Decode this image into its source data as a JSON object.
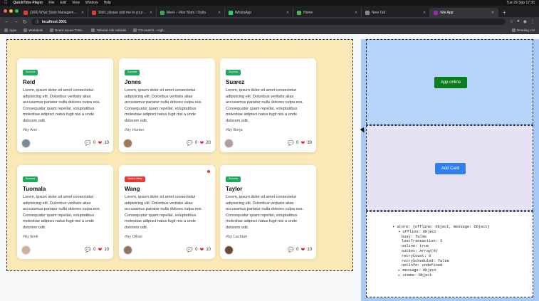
{
  "menubar": {
    "app": "QuickTime Player",
    "items": [
      "File",
      "Edit",
      "View",
      "Window",
      "Help"
    ],
    "clock": "Tue 29 Sep 17:30"
  },
  "tabs": [
    {
      "title": "(160) What State Management...",
      "color": "#e53935"
    },
    {
      "title": "Shirt, please add me to your l...",
      "color": "#e53935"
    },
    {
      "title": "Meet – Vitor Mato / Dalia",
      "color": "#34a853"
    },
    {
      "title": "WhatsApp",
      "color": "#25d366"
    },
    {
      "title": "Home",
      "color": "#4caf50"
    },
    {
      "title": "New Tab",
      "color": "#888888"
    },
    {
      "title": "Vite App",
      "color": "#9c27b0"
    }
  ],
  "address": {
    "url": "localhost:3001"
  },
  "bookmarks": {
    "items": [
      "Apps",
      "Workdesk",
      "Board Issues Tutor...",
      "Tailwind Lab Helsinki",
      "CN Search – Hgh..."
    ],
    "reading": "Reading List"
  },
  "cards": [
    {
      "badge": "Success",
      "badge_color": "#22a85b",
      "name": "Reid",
      "body": "Lorem, ipsum dolor sit amet consectetur adipisicing elit. Doloribus veritatis alias accusamus pariatur nulla dolores culpa eos. Consequatur quam repellat, voluptatibus molestiae adipisci natus fugit nisi a unde dolorem odit.",
      "by": "#by Ann",
      "comments": "0",
      "likes": "10",
      "avatar": "#7a8a9a",
      "dot": false
    },
    {
      "badge": "Success",
      "badge_color": "#22a85b",
      "name": "Jones",
      "body": "Lorem, ipsum dolor sit amet consectetur adipisicing elit. Doloribus veritatis alias accusamus pariatur nulla dolores culpa eos. Consequatur quam repellat, voluptatibus molestiae adipisci natus fugit nisi a unde dolorem odit.",
      "by": "#by Hunter",
      "comments": "0",
      "likes": "20",
      "avatar": "#a0785a",
      "dot": false
    },
    {
      "badge": "Success",
      "badge_color": "#22a85b",
      "name": "Suarez",
      "body": "Lorem, ipsum dolor sit amet consectetur adipisicing elit. Doloribus veritatis alias accusamus pariatur nulla dolores culpa eos. Consequatur quam repellat, voluptatibus molestiae adipisci natus fugit nisi a unde dolorem odit.",
      "by": "#by Borja",
      "comments": "0",
      "likes": "30",
      "avatar": "#b59aa0",
      "dot": false
    },
    {
      "badge": "Success",
      "badge_color": "#22a85b",
      "name": "Tuomala",
      "body": "Lorem, ipsum dolor sit amet consectetur adipisicing elit. Doloribus veritatis alias accusamus pariatur nulla dolores culpa eos. Consequatur quam repellat, voluptatibus molestiae adipisci natus fugit nisi a unde dolorem odit.",
      "by": "#by Emil",
      "comments": "0",
      "likes": "10",
      "avatar": "#c9b2a0",
      "dot": false
    },
    {
      "badge": "Click to Retry",
      "badge_color": "#e53935",
      "name": "Wang",
      "body": "Lorem, ipsum dolor sit amet consectetur adipisicing elit. Doloribus veritatis alias accusamus pariatur nulla dolores culpa eos. Consequatur quam repellat, voluptatibus molestiae adipisci natus fugit nisi a unde dolorem odit.",
      "by": "#by Oliver",
      "comments": "0",
      "likes": "10",
      "avatar": "#8d7666",
      "dot": true
    },
    {
      "badge": "Success",
      "badge_color": "#22a85b",
      "name": "Taylor",
      "body": "Lorem, ipsum dolor sit amet consectetur adipisicing elit. Doloribus veritatis alias accusamus pariatur nulla dolores culpa eos. Consequatur quam repellat, voluptatibus molestiae adipisci natus fugit nisi a unde dolorem odit.",
      "by": "#by Lachlan",
      "comments": "0",
      "likes": "10",
      "avatar": "#6a4a3a",
      "dot": false
    }
  ],
  "controls": {
    "online_label": "App online",
    "add_label": "Add Card"
  },
  "store_lines": [
    {
      "t": "▾ store: {offline: Object, message: Object}"
    },
    {
      "t": "▾ offline: Object"
    },
    {
      "t": "busy: false"
    },
    {
      "t": "lastTransaction: 3"
    },
    {
      "t": "online: true"
    },
    {
      "t": "outbox: Array(0)"
    },
    {
      "t": "retryCount: 0"
    },
    {
      "t": "retryScheduled: false"
    },
    {
      "t": "netInfo: undefined"
    },
    {
      "t": "▸ message: Object"
    },
    {
      "t": "▸ items: Object"
    }
  ]
}
